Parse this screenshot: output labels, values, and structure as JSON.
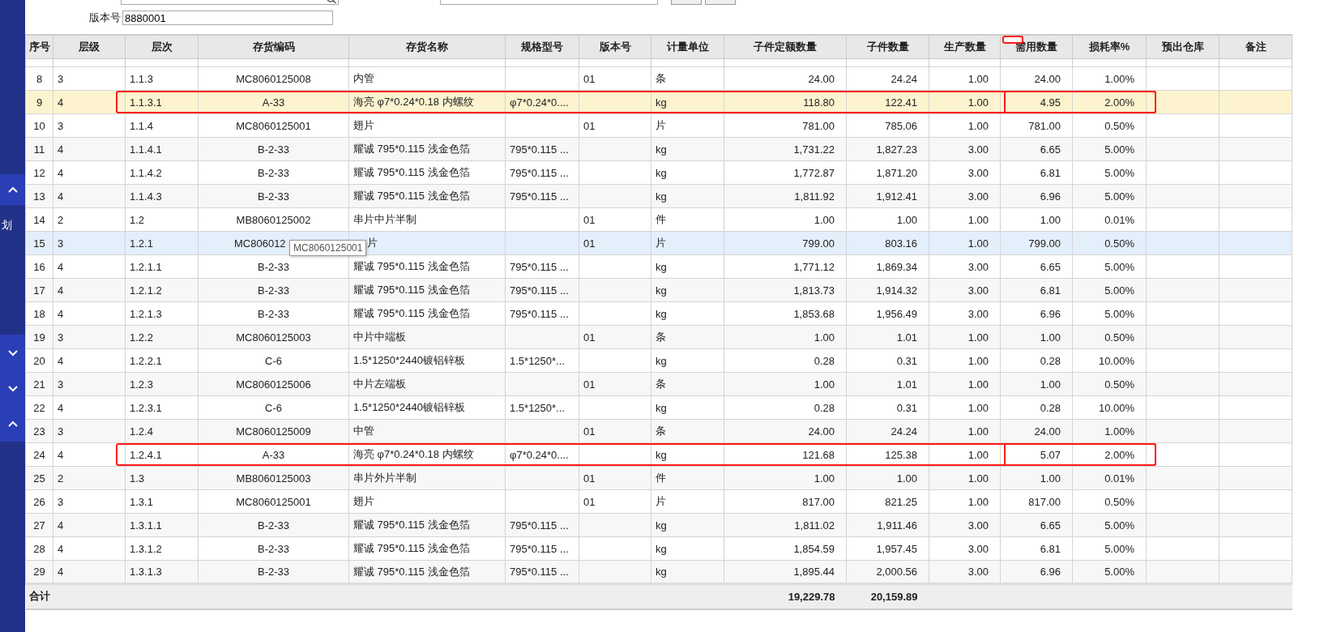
{
  "sidebar": {
    "groups": [
      {
        "kind": "buttons",
        "items": [
          {
            "kind": "up"
          }
        ]
      },
      {
        "kind": "label",
        "label": "划"
      },
      {
        "kind": "buttons",
        "items": [
          {
            "kind": "down"
          },
          {
            "kind": "down"
          },
          {
            "kind": "up"
          }
        ]
      }
    ]
  },
  "filter": {
    "label": "版本号",
    "value": "8880001"
  },
  "table": {
    "columns": [
      {
        "label": "序号",
        "marked": false
      },
      {
        "label": "层级",
        "marked": false
      },
      {
        "label": "层次",
        "marked": false
      },
      {
        "label": "存货编码",
        "marked": false
      },
      {
        "label": "存货名称",
        "marked": false
      },
      {
        "label": "规格型号",
        "marked": false
      },
      {
        "label": "版本号",
        "marked": false
      },
      {
        "label": "计量单位",
        "marked": false
      },
      {
        "label": "子件定额数量",
        "marked": false
      },
      {
        "label": "子件数量",
        "marked": false
      },
      {
        "label": "生产数量",
        "marked": false
      },
      {
        "label": "需用数量",
        "marked": true
      },
      {
        "label": "损耗率%",
        "marked": false
      },
      {
        "label": "预出仓库",
        "marked": false
      },
      {
        "label": "备注",
        "marked": false
      }
    ],
    "rows": [
      {
        "no": "8",
        "level": "3",
        "path": "1.1.3",
        "code": "MC8060125008",
        "name": "内管",
        "version": "01",
        "unit": "条",
        "quota": "24.00",
        "child_qty": "24.24",
        "prod_qty": "1.00",
        "need_qty": "24.00",
        "loss": "1.00%",
        "selected": false,
        "hovered": false,
        "outlined": false,
        "boxed": false
      },
      {
        "no": "9",
        "level": "4",
        "path": "1.1.3.1",
        "code": "A-33",
        "name": "海亮 φ7*0.24*0.18 内螺纹",
        "spec": "φ7*0.24*0....",
        "unit": "kg",
        "quota": "118.80",
        "child_qty": "122.41",
        "prod_qty": "1.00",
        "need_qty": "4.95",
        "loss": "2.00%",
        "selected": true,
        "hovered": false,
        "outlined": true,
        "boxed": true
      },
      {
        "no": "10",
        "level": "3",
        "path": "1.1.4",
        "code": "MC8060125001",
        "name": "翅片",
        "version": "01",
        "unit": "片",
        "quota": "781.00",
        "child_qty": "785.06",
        "prod_qty": "1.00",
        "need_qty": "781.00",
        "loss": "0.50%",
        "selected": false,
        "hovered": false,
        "outlined": false,
        "boxed": false
      },
      {
        "no": "11",
        "level": "4",
        "path": "1.1.4.1",
        "code": "B-2-33",
        "name": "耀诚 795*0.115 浅金色箔",
        "spec": "795*0.115 ...",
        "unit": "kg",
        "quota": "1,731.22",
        "child_qty": "1,827.23",
        "prod_qty": "3.00",
        "need_qty": "6.65",
        "loss": "5.00%",
        "selected": false,
        "hovered": false,
        "outlined": false,
        "boxed": false
      },
      {
        "no": "12",
        "level": "4",
        "path": "1.1.4.2",
        "code": "B-2-33",
        "name": "耀诚 795*0.115 浅金色箔",
        "spec": "795*0.115 ...",
        "unit": "kg",
        "quota": "1,772.87",
        "child_qty": "1,871.20",
        "prod_qty": "3.00",
        "need_qty": "6.81",
        "loss": "5.00%",
        "selected": false,
        "hovered": false,
        "outlined": false,
        "boxed": false
      },
      {
        "no": "13",
        "level": "4",
        "path": "1.1.4.3",
        "code": "B-2-33",
        "name": "耀诚 795*0.115 浅金色箔",
        "spec": "795*0.115 ...",
        "unit": "kg",
        "quota": "1,811.92",
        "child_qty": "1,912.41",
        "prod_qty": "3.00",
        "need_qty": "6.96",
        "loss": "5.00%",
        "selected": false,
        "hovered": false,
        "outlined": false,
        "boxed": false
      },
      {
        "no": "14",
        "level": "2",
        "path": "1.2",
        "code": "MB8060125002",
        "name": "串片中片半制",
        "version": "01",
        "unit": "件",
        "quota": "1.00",
        "child_qty": "1.00",
        "prod_qty": "1.00",
        "need_qty": "1.00",
        "loss": "0.01%",
        "selected": false,
        "hovered": false,
        "outlined": false,
        "boxed": false
      },
      {
        "no": "15",
        "level": "3",
        "path": "1.2.1",
        "code": "MC806012",
        "tooltip": "MC8060125001",
        "name": "片",
        "version": "01",
        "unit": "片",
        "quota": "799.00",
        "child_qty": "803.16",
        "prod_qty": "1.00",
        "need_qty": "799.00",
        "loss": "0.50%",
        "selected": false,
        "hovered": true,
        "outlined": false,
        "boxed": false
      },
      {
        "no": "16",
        "level": "4",
        "path": "1.2.1.1",
        "code": "B-2-33",
        "name": "耀诚 795*0.115 浅金色箔",
        "spec": "795*0.115 ...",
        "unit": "kg",
        "quota": "1,771.12",
        "child_qty": "1,869.34",
        "prod_qty": "3.00",
        "need_qty": "6.65",
        "loss": "5.00%",
        "selected": false,
        "hovered": false,
        "outlined": false,
        "boxed": false
      },
      {
        "no": "17",
        "level": "4",
        "path": "1.2.1.2",
        "code": "B-2-33",
        "name": "耀诚 795*0.115 浅金色箔",
        "spec": "795*0.115 ...",
        "unit": "kg",
        "quota": "1,813.73",
        "child_qty": "1,914.32",
        "prod_qty": "3.00",
        "need_qty": "6.81",
        "loss": "5.00%",
        "selected": false,
        "hovered": false,
        "outlined": false,
        "boxed": false
      },
      {
        "no": "18",
        "level": "4",
        "path": "1.2.1.3",
        "code": "B-2-33",
        "name": "耀诚 795*0.115 浅金色箔",
        "spec": "795*0.115 ...",
        "unit": "kg",
        "quota": "1,853.68",
        "child_qty": "1,956.49",
        "prod_qty": "3.00",
        "need_qty": "6.96",
        "loss": "5.00%",
        "selected": false,
        "hovered": false,
        "outlined": false,
        "boxed": false
      },
      {
        "no": "19",
        "level": "3",
        "path": "1.2.2",
        "code": "MC8060125003",
        "name": "中片中端板",
        "version": "01",
        "unit": "条",
        "quota": "1.00",
        "child_qty": "1.01",
        "prod_qty": "1.00",
        "need_qty": "1.00",
        "loss": "0.50%",
        "selected": false,
        "hovered": false,
        "outlined": false,
        "boxed": false
      },
      {
        "no": "20",
        "level": "4",
        "path": "1.2.2.1",
        "code": "C-6",
        "name": "1.5*1250*2440镀铝锌板",
        "spec": "1.5*1250*...",
        "unit": "kg",
        "quota": "0.28",
        "child_qty": "0.31",
        "prod_qty": "1.00",
        "need_qty": "0.28",
        "loss": "10.00%",
        "selected": false,
        "hovered": false,
        "outlined": false,
        "boxed": false
      },
      {
        "no": "21",
        "level": "3",
        "path": "1.2.3",
        "code": "MC8060125006",
        "name": "中片左端板",
        "version": "01",
        "unit": "条",
        "quota": "1.00",
        "child_qty": "1.01",
        "prod_qty": "1.00",
        "need_qty": "1.00",
        "loss": "0.50%",
        "selected": false,
        "hovered": false,
        "outlined": false,
        "boxed": false
      },
      {
        "no": "22",
        "level": "4",
        "path": "1.2.3.1",
        "code": "C-6",
        "name": "1.5*1250*2440镀铝锌板",
        "spec": "1.5*1250*...",
        "unit": "kg",
        "quota": "0.28",
        "child_qty": "0.31",
        "prod_qty": "1.00",
        "need_qty": "0.28",
        "loss": "10.00%",
        "selected": false,
        "hovered": false,
        "outlined": false,
        "boxed": false
      },
      {
        "no": "23",
        "level": "3",
        "path": "1.2.4",
        "code": "MC8060125009",
        "name": "中管",
        "version": "01",
        "unit": "条",
        "quota": "24.00",
        "child_qty": "24.24",
        "prod_qty": "1.00",
        "need_qty": "24.00",
        "loss": "1.00%",
        "selected": false,
        "hovered": false,
        "outlined": false,
        "boxed": false
      },
      {
        "no": "24",
        "level": "4",
        "path": "1.2.4.1",
        "code": "A-33",
        "name": "海亮 φ7*0.24*0.18 内螺纹",
        "spec": "φ7*0.24*0....",
        "unit": "kg",
        "quota": "121.68",
        "child_qty": "125.38",
        "prod_qty": "1.00",
        "need_qty": "5.07",
        "loss": "2.00%",
        "selected": false,
        "hovered": false,
        "outlined": true,
        "boxed": true
      },
      {
        "no": "25",
        "level": "2",
        "path": "1.3",
        "code": "MB8060125003",
        "name": "串片外片半制",
        "version": "01",
        "unit": "件",
        "quota": "1.00",
        "child_qty": "1.00",
        "prod_qty": "1.00",
        "need_qty": "1.00",
        "loss": "0.01%",
        "selected": false,
        "hovered": false,
        "outlined": false,
        "boxed": false
      },
      {
        "no": "26",
        "level": "3",
        "path": "1.3.1",
        "code": "MC8060125001",
        "name": "翅片",
        "version": "01",
        "unit": "片",
        "quota": "817.00",
        "child_qty": "821.25",
        "prod_qty": "1.00",
        "need_qty": "817.00",
        "loss": "0.50%",
        "selected": false,
        "hovered": false,
        "outlined": false,
        "boxed": false
      },
      {
        "no": "27",
        "level": "4",
        "path": "1.3.1.1",
        "code": "B-2-33",
        "name": "耀诚 795*0.115 浅金色箔",
        "spec": "795*0.115 ...",
        "unit": "kg",
        "quota": "1,811.02",
        "child_qty": "1,911.46",
        "prod_qty": "3.00",
        "need_qty": "6.65",
        "loss": "5.00%",
        "selected": false,
        "hovered": false,
        "outlined": false,
        "boxed": false
      },
      {
        "no": "28",
        "level": "4",
        "path": "1.3.1.2",
        "code": "B-2-33",
        "name": "耀诚 795*0.115 浅金色箔",
        "spec": "795*0.115 ...",
        "unit": "kg",
        "quota": "1,854.59",
        "child_qty": "1,957.45",
        "prod_qty": "3.00",
        "need_qty": "6.81",
        "loss": "5.00%",
        "selected": false,
        "hovered": false,
        "outlined": false,
        "boxed": false
      },
      {
        "no": "29",
        "level": "4",
        "path": "1.3.1.3",
        "code": "B-2-33",
        "name": "耀诚 795*0.115 浅金色箔",
        "spec": "795*0.115 ...",
        "unit": "kg",
        "quota": "1,895.44",
        "child_qty": "2,000.56",
        "prod_qty": "3.00",
        "need_qty": "6.96",
        "loss": "5.00%",
        "selected": false,
        "hovered": false,
        "outlined": false,
        "boxed": false
      }
    ],
    "total": {
      "label": "合计",
      "quota": "19,229.78",
      "child_qty": "20,159.89"
    }
  }
}
